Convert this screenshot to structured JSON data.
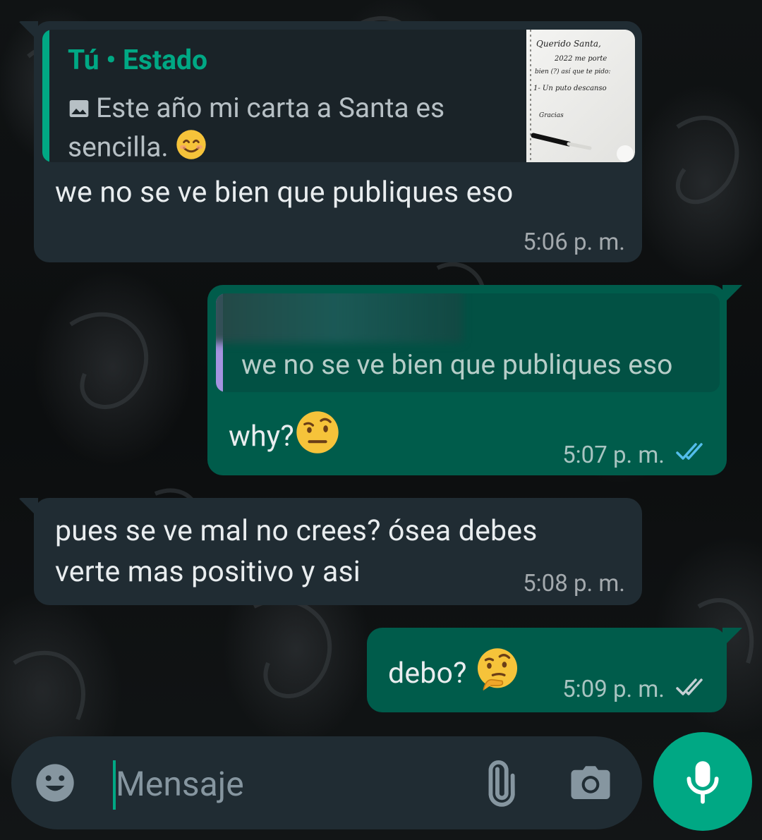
{
  "messages": [
    {
      "direction": "incoming",
      "reply": {
        "author": "Tú • Estado",
        "text": "Este año mi carta a Santa es sencilla.",
        "thumbnail_lines": [
          "Querido Santa,",
          "2022 me porte",
          "bien (?) así que te pido:",
          "1- Un puto descanso",
          "Gracias"
        ]
      },
      "text": "we no se ve bien que publiques eso",
      "time": "5:06 p. m."
    },
    {
      "direction": "outgoing",
      "reply": {
        "text": "we no se ve bien que publiques eso"
      },
      "text": "why?",
      "time": "5:07 p. m.",
      "status": "read"
    },
    {
      "direction": "incoming",
      "text_line1": "pues se ve mal no crees? ósea debes",
      "text_line2": "verte mas positivo y asi",
      "time": "5:08 p. m."
    },
    {
      "direction": "outgoing",
      "text": "debo?",
      "time": "5:09 p. m.",
      "status": "delivered"
    }
  ],
  "composer": {
    "placeholder": "Mensaje"
  },
  "colors": {
    "incoming_bubble": "#202c33",
    "outgoing_bubble": "#005c4b",
    "accent": "#00a884",
    "read_ticks": "#53bdeb",
    "delivered_ticks": "#c5d0d4"
  },
  "icons": [
    "emoji-icon",
    "attach-icon",
    "camera-icon",
    "mic-icon",
    "image-icon"
  ]
}
